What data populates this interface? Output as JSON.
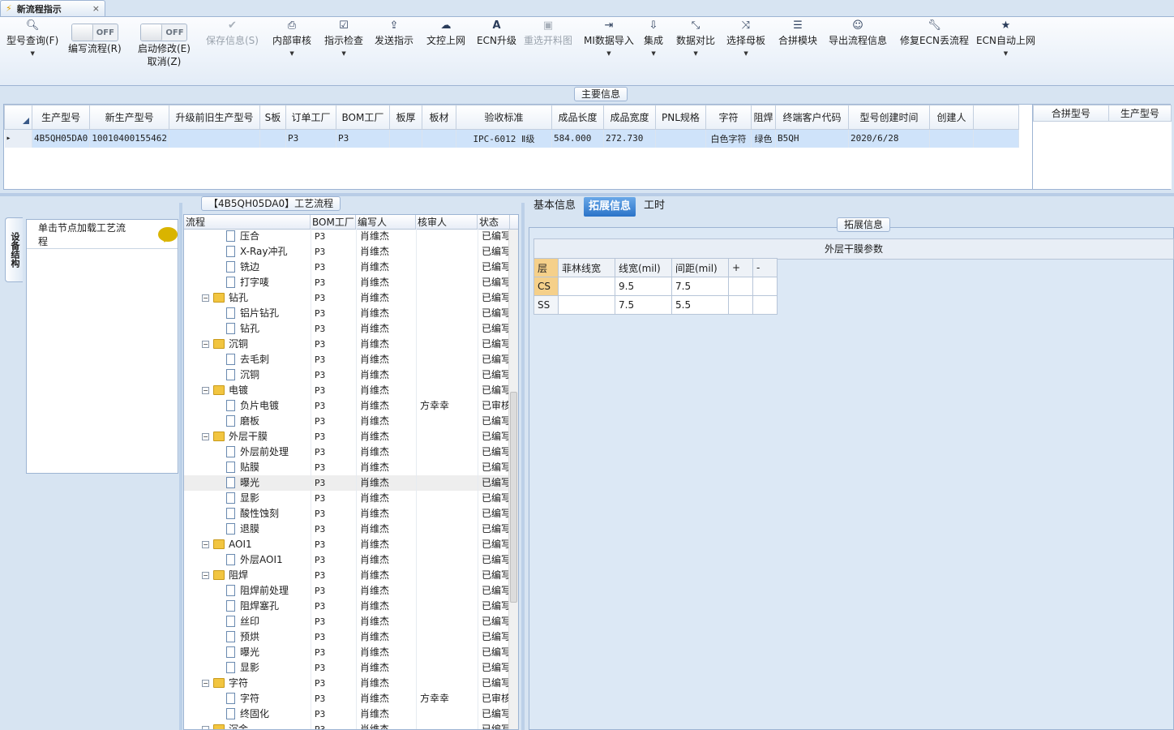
{
  "window": {
    "tab_title": "新流程指示",
    "close": "×"
  },
  "toolbar": {
    "buttons": [
      {
        "label": "型号查询(F)",
        "icon": "search-icon"
      },
      {
        "label": "编写流程(R)",
        "toggle": "OFF"
      },
      {
        "label": "启动修改(E)",
        "label2": "取消(Z)",
        "toggle": "OFF"
      },
      {
        "label": "保存信息(S)",
        "icon": "check-icon"
      },
      {
        "label": "内部审核",
        "icon": "printer-icon"
      },
      {
        "label": "指示检查",
        "icon": "checkbox-icon"
      },
      {
        "label": "发送指示",
        "icon": "upload-icon"
      },
      {
        "label": "文控上网",
        "icon": "cloud-upload-icon"
      },
      {
        "label": "ECN升级",
        "icon": "font-icon"
      },
      {
        "label": "重选开料图",
        "icon": "image-icon"
      },
      {
        "label": "MI数据导入",
        "icon": "import-icon"
      },
      {
        "label": "集成",
        "icon": "download-icon"
      },
      {
        "label": "数据对比",
        "icon": "compress-icon"
      },
      {
        "label": "选择母板",
        "icon": "shuffle-icon"
      },
      {
        "label": "合拼模块",
        "icon": "list-icon"
      },
      {
        "label": "导出流程信息",
        "icon": "smile-icon"
      },
      {
        "label": "修复ECN丢流程",
        "icon": "wrench-icon"
      },
      {
        "label": "ECN自动上网",
        "icon": "star-icon"
      }
    ]
  },
  "main_info": {
    "section_title": "主要信息",
    "columns": [
      "生产型号",
      "新生产型号",
      "升级前旧生产型号",
      "S板",
      "订单工厂",
      "BOM工厂",
      "板厚",
      "板材",
      "验收标准",
      "成品长度",
      "成品宽度",
      "PNL规格",
      "字符",
      "阻焊",
      "终端客户代码",
      "型号创建时间",
      "创建人"
    ],
    "rows": [
      [
        "4B5QH05DA0",
        "10010400155462",
        "",
        "",
        "P3",
        "P3",
        "",
        "",
        "IPC-6012 Ⅱ级",
        "584.000",
        "272.730",
        "",
        "白色字符",
        "绿色",
        "B5QH",
        "2020/6/28",
        ""
      ]
    ],
    "merge_columns": [
      "合拼型号",
      "生产型号"
    ]
  },
  "left_nav": {
    "vertical_tab": "设备结构",
    "hint": "单击节点加载工艺流程"
  },
  "process": {
    "title": "【4B5QH05DA0】工艺流程",
    "columns": [
      "流程",
      "BOM工厂",
      "编写人",
      "核审人",
      "状态"
    ],
    "rows": [
      {
        "name": "压合",
        "level": 2,
        "type": "doc",
        "bom": "P3",
        "writer": "肖维杰",
        "reviewer": "",
        "status": "已编写"
      },
      {
        "name": "X-Ray冲孔",
        "level": 2,
        "type": "doc",
        "bom": "P3",
        "writer": "肖维杰",
        "reviewer": "",
        "status": "已编写"
      },
      {
        "name": "铣边",
        "level": 2,
        "type": "doc",
        "bom": "P3",
        "writer": "肖维杰",
        "reviewer": "",
        "status": "已编写"
      },
      {
        "name": "打字唛",
        "level": 2,
        "type": "doc",
        "bom": "P3",
        "writer": "肖维杰",
        "reviewer": "",
        "status": "已编写"
      },
      {
        "name": "钻孔",
        "level": 1,
        "type": "folder",
        "bom": "P3",
        "writer": "肖维杰",
        "reviewer": "",
        "status": "已编写"
      },
      {
        "name": "铝片钻孔",
        "level": 2,
        "type": "doc",
        "bom": "P3",
        "writer": "肖维杰",
        "reviewer": "",
        "status": "已编写"
      },
      {
        "name": "钻孔",
        "level": 2,
        "type": "doc",
        "bom": "P3",
        "writer": "肖维杰",
        "reviewer": "",
        "status": "已编写"
      },
      {
        "name": "沉铜",
        "level": 1,
        "type": "folder",
        "bom": "P3",
        "writer": "肖维杰",
        "reviewer": "",
        "status": "已编写"
      },
      {
        "name": "去毛刺",
        "level": 2,
        "type": "doc",
        "bom": "P3",
        "writer": "肖维杰",
        "reviewer": "",
        "status": "已编写"
      },
      {
        "name": "沉铜",
        "level": 2,
        "type": "doc",
        "bom": "P3",
        "writer": "肖维杰",
        "reviewer": "",
        "status": "已编写"
      },
      {
        "name": "电镀",
        "level": 1,
        "type": "folder",
        "bom": "P3",
        "writer": "肖维杰",
        "reviewer": "",
        "status": "已编写"
      },
      {
        "name": "负片电镀",
        "level": 2,
        "type": "doc",
        "bom": "P3",
        "writer": "肖维杰",
        "reviewer": "方幸幸",
        "status": "已审核"
      },
      {
        "name": "磨板",
        "level": 2,
        "type": "doc",
        "bom": "P3",
        "writer": "肖维杰",
        "reviewer": "",
        "status": "已编写"
      },
      {
        "name": "外层干膜",
        "level": 1,
        "type": "folder",
        "bom": "P3",
        "writer": "肖维杰",
        "reviewer": "",
        "status": "已编写"
      },
      {
        "name": "外层前处理",
        "level": 2,
        "type": "doc",
        "bom": "P3",
        "writer": "肖维杰",
        "reviewer": "",
        "status": "已编写"
      },
      {
        "name": "贴膜",
        "level": 2,
        "type": "doc",
        "bom": "P3",
        "writer": "肖维杰",
        "reviewer": "",
        "status": "已编写"
      },
      {
        "name": "曝光",
        "level": 2,
        "type": "doc",
        "bom": "P3",
        "writer": "肖维杰",
        "reviewer": "",
        "status": "已编写",
        "selected": true
      },
      {
        "name": "显影",
        "level": 2,
        "type": "doc",
        "bom": "P3",
        "writer": "肖维杰",
        "reviewer": "",
        "status": "已编写"
      },
      {
        "name": "酸性蚀刻",
        "level": 2,
        "type": "doc",
        "bom": "P3",
        "writer": "肖维杰",
        "reviewer": "",
        "status": "已编写"
      },
      {
        "name": "退膜",
        "level": 2,
        "type": "doc",
        "bom": "P3",
        "writer": "肖维杰",
        "reviewer": "",
        "status": "已编写"
      },
      {
        "name": "AOI1",
        "level": 1,
        "type": "folder",
        "bom": "P3",
        "writer": "肖维杰",
        "reviewer": "",
        "status": "已编写"
      },
      {
        "name": "外层AOI1",
        "level": 2,
        "type": "doc",
        "bom": "P3",
        "writer": "肖维杰",
        "reviewer": "",
        "status": "已编写"
      },
      {
        "name": "阻焊",
        "level": 1,
        "type": "folder",
        "bom": "P3",
        "writer": "肖维杰",
        "reviewer": "",
        "status": "已编写"
      },
      {
        "name": "阻焊前处理",
        "level": 2,
        "type": "doc",
        "bom": "P3",
        "writer": "肖维杰",
        "reviewer": "",
        "status": "已编写"
      },
      {
        "name": "阻焊塞孔",
        "level": 2,
        "type": "doc",
        "bom": "P3",
        "writer": "肖维杰",
        "reviewer": "",
        "status": "已编写"
      },
      {
        "name": "丝印",
        "level": 2,
        "type": "doc",
        "bom": "P3",
        "writer": "肖维杰",
        "reviewer": "",
        "status": "已编写"
      },
      {
        "name": "预烘",
        "level": 2,
        "type": "doc",
        "bom": "P3",
        "writer": "肖维杰",
        "reviewer": "",
        "status": "已编写"
      },
      {
        "name": "曝光",
        "level": 2,
        "type": "doc",
        "bom": "P3",
        "writer": "肖维杰",
        "reviewer": "",
        "status": "已编写"
      },
      {
        "name": "显影",
        "level": 2,
        "type": "doc",
        "bom": "P3",
        "writer": "肖维杰",
        "reviewer": "",
        "status": "已编写"
      },
      {
        "name": "字符",
        "level": 1,
        "type": "folder",
        "bom": "P3",
        "writer": "肖维杰",
        "reviewer": "",
        "status": "已编写"
      },
      {
        "name": "字符",
        "level": 2,
        "type": "doc",
        "bom": "P3",
        "writer": "肖维杰",
        "reviewer": "方幸幸",
        "status": "已审核"
      },
      {
        "name": "终固化",
        "level": 2,
        "type": "doc",
        "bom": "P3",
        "writer": "肖维杰",
        "reviewer": "",
        "status": "已编写"
      },
      {
        "name": "沉金",
        "level": 1,
        "type": "folder",
        "bom": "P3",
        "writer": "肖维杰",
        "reviewer": "",
        "status": "已编写"
      }
    ]
  },
  "right": {
    "tabs": [
      "基本信息",
      "拓展信息",
      "工时"
    ],
    "active_tab": 1,
    "section_title": "拓展信息",
    "film_title": "外层干膜参数",
    "film_columns": [
      "层",
      "菲林线宽",
      "线宽(mil)",
      "间距(mil)",
      "+",
      "-"
    ],
    "film_rows": [
      [
        "CS",
        "",
        "9.5",
        "7.5",
        "",
        ""
      ],
      [
        "SS",
        "",
        "7.5",
        "5.5",
        "",
        ""
      ]
    ]
  }
}
